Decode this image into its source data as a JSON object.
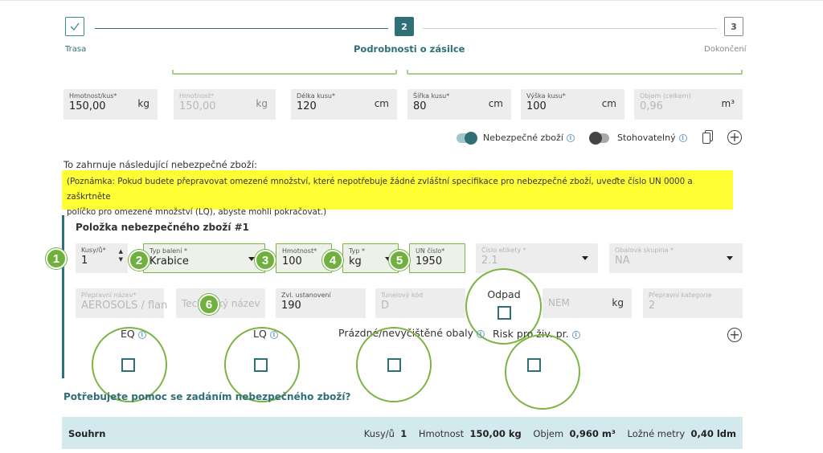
{
  "stepper": {
    "step1": {
      "label": "Trasa",
      "number": ""
    },
    "step2": {
      "label": "Podrobnosti o zásilce",
      "number": "2"
    },
    "step3": {
      "label": "Dokončení",
      "number": "3"
    }
  },
  "measures": {
    "weight_per_piece": {
      "label": "Hmotnost/kus*",
      "value": "150,00",
      "unit": "kg"
    },
    "weight": {
      "label": "Hmotnost*",
      "value": "150,00",
      "unit": "kg"
    },
    "length": {
      "label": "Délka kusu*",
      "value": "120",
      "unit": "cm"
    },
    "width": {
      "label": "Šířka kusu*",
      "value": "80",
      "unit": "cm"
    },
    "height": {
      "label": "Výška kusu*",
      "value": "100",
      "unit": "cm"
    },
    "volume": {
      "label": "Objem (celkem)",
      "value": "0,96",
      "unit": "m³"
    }
  },
  "toggles": {
    "dangerous": {
      "label": "Nebezpečné zboží",
      "on": true
    },
    "stackable": {
      "label": "Stohovatelný",
      "on": false
    }
  },
  "dg_intro": "To zahrnuje následující nebezpečné zboží:",
  "note_line1": "(Poznámka: Pokud budete přepravovat omezené množství, které nepotřebuje žádné zvláštní specifikace pro nebezpečné zboží, uveďte číslo UN 0000 a zaškrtněte",
  "note_line2": "políčko pro omezené množství (LQ), abyste mohli pokračovat.)",
  "item": {
    "title": "Položka nebezpečného zboží #1",
    "pieces": {
      "label": "Kusy/ů*",
      "value": "1"
    },
    "package_type": {
      "label": "Typ balení *",
      "value": "Krabice"
    },
    "weight": {
      "label": "Hmotnost*",
      "value": "100"
    },
    "type": {
      "label": "Typ *",
      "value": "kg"
    },
    "un_number": {
      "label": "UN číslo*",
      "value": "1950"
    },
    "label_number": {
      "label": "Číslo etikety *",
      "value": "2.1"
    },
    "packing_group": {
      "label": "Obalová skupina *",
      "value": "NA"
    },
    "shipping_name": {
      "label": "Přepravní název*",
      "value": "AEROSOLS / flan"
    },
    "tech_name": {
      "placeholder": "Technický název"
    },
    "special_provision": {
      "label": "Zvl. ustanovení",
      "value": "190"
    },
    "tunnel_code": {
      "label": "Tunelový kód",
      "value": "D"
    },
    "nem": {
      "placeholder": "NEM",
      "unit": "kg"
    },
    "transport_category": {
      "label": "Přepravní kategorie",
      "value": "2"
    },
    "checkboxes": {
      "eq": "EQ",
      "lq": "LQ",
      "empty": "Prázdné/nevyčištěné obaly",
      "waste": "Odpad",
      "env_risk": "Risk pro živ. pr."
    }
  },
  "badges": [
    "1",
    "2",
    "3",
    "4",
    "5",
    "6"
  ],
  "help_link": "Potřebujete pomoc se zadáním nebezpečného zboží?",
  "summary": {
    "title": "Souhrn",
    "pieces_label": "Kusy/ů",
    "pieces_value": "1",
    "weight_label": "Hmotnost",
    "weight_value": "150,00 kg",
    "volume_label": "Objem",
    "volume_value": "0,960 m³",
    "ldm_label": "Ložné metry",
    "ldm_value": "0,40 ldm"
  },
  "colors": {
    "teal": "#2f6f78",
    "highlight": "#ffff33",
    "badge_green": "#6fb03f",
    "summary_bg": "#d4e9ee"
  },
  "icons": [
    "check-icon",
    "info-icon",
    "copy-icon",
    "plus-icon",
    "chevron-down-icon"
  ]
}
